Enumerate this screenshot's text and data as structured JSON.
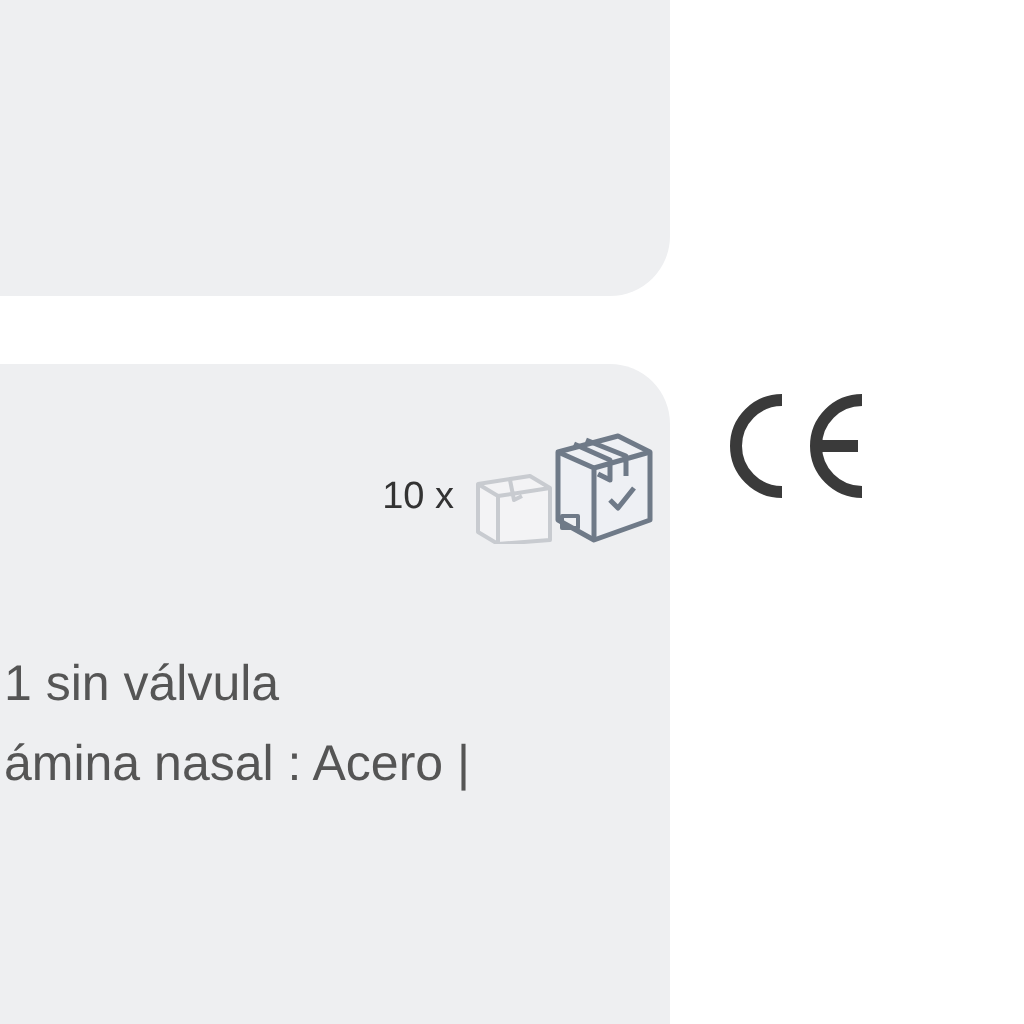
{
  "top_card": {
    "kind": "panel"
  },
  "product_card": {
    "pack_count": "10 x",
    "description_lines": [
      "1 sin válvula",
      "ámina nasal : Acero |"
    ]
  }
}
